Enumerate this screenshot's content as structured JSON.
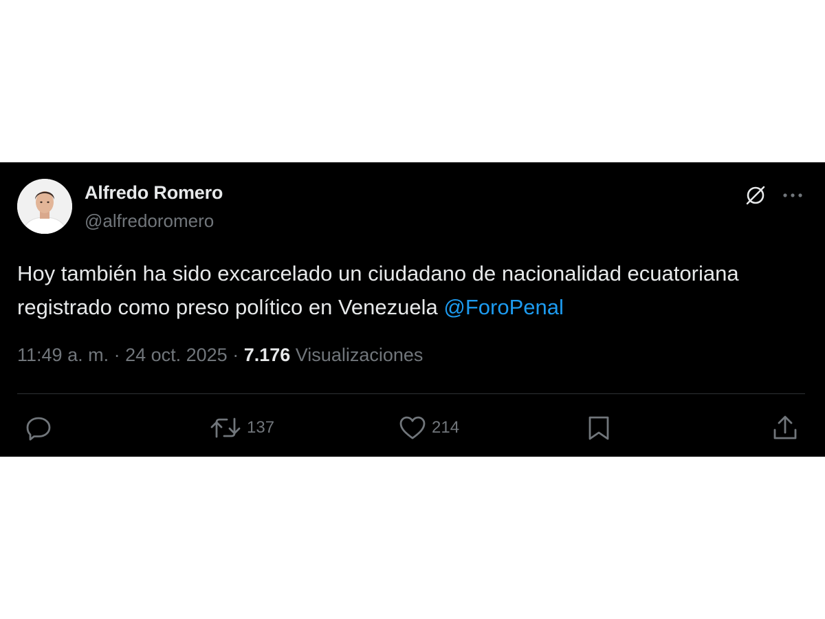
{
  "tweet": {
    "author_name": "Alfredo Romero",
    "author_handle": "@alfredoromero",
    "avatar_icon": "profile-photo",
    "text": "Hoy también ha sido excarcelado un ciudadano de nacionalidad ecuatoriana registrado como preso político en Venezuela ",
    "mention": "@ForoPenal",
    "time": "11:49 a. m.",
    "separator": " · ",
    "date": "24 oct. 2025",
    "views_count": "7.176",
    "views_label": " Visualizaciones"
  },
  "actions": {
    "reply_icon": "comment-icon",
    "retweet_count": "137",
    "like_count": "214",
    "bookmark_icon": "bookmark-icon",
    "share_icon": "share-icon"
  },
  "colors": {
    "background": "#000000",
    "text": "#e7e9ea",
    "secondary": "#71767b",
    "link": "#1d9bf0",
    "divider": "#2f3336"
  }
}
